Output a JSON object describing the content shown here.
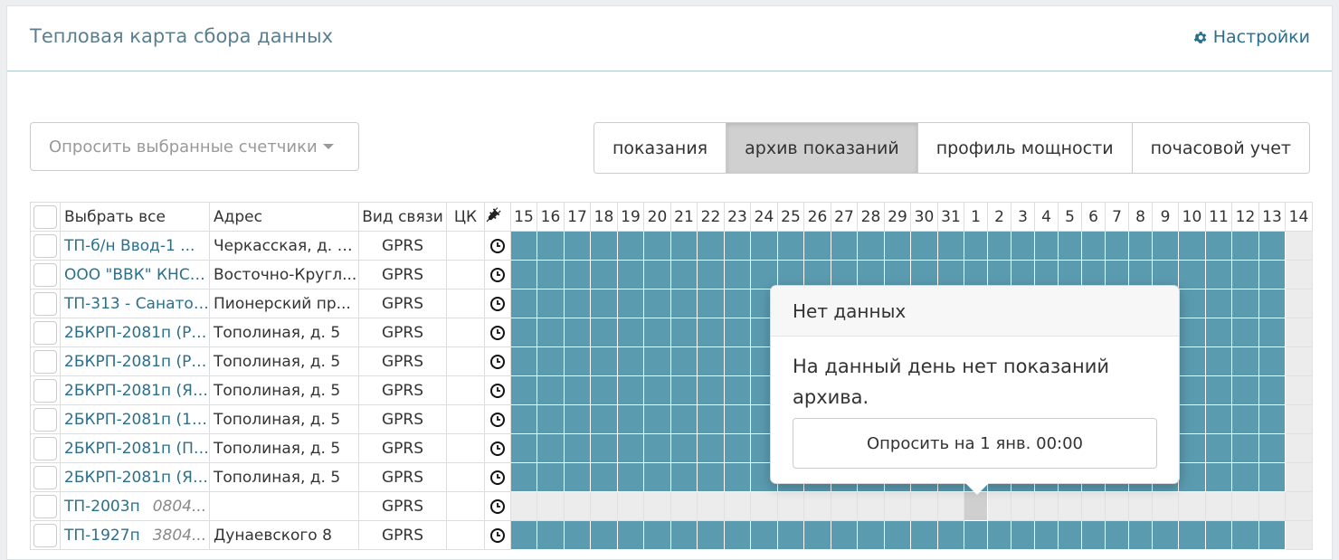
{
  "header": {
    "title": "Тепловая карта сбора данных",
    "settings_label": "Настройки"
  },
  "poll_button": {
    "label": "Опросить выбранные счетчики"
  },
  "tabs": [
    {
      "label": "показания",
      "active": false
    },
    {
      "label": "архив показаний",
      "active": true
    },
    {
      "label": "профиль мощности",
      "active": false
    },
    {
      "label": "почасовой учет",
      "active": false
    }
  ],
  "table": {
    "headers": {
      "select_all": "Выбрать все",
      "address": "Адрес",
      "connection": "Вид связи",
      "ck": "ЦК"
    },
    "days": [
      "15",
      "16",
      "17",
      "18",
      "19",
      "20",
      "21",
      "22",
      "23",
      "24",
      "25",
      "26",
      "27",
      "28",
      "29",
      "30",
      "31",
      "1",
      "2",
      "3",
      "4",
      "5",
      "6",
      "7",
      "8",
      "9",
      "10",
      "11",
      "12",
      "13",
      "14"
    ],
    "rows": [
      {
        "name": "ТП-б/н Ввод-1 ...",
        "sub": "",
        "address": "Черкасская, д. 7...",
        "connection": "GPRS",
        "filled": true
      },
      {
        "name": "ООО \"ВВК\" КНС ...",
        "sub": "",
        "address": "Восточно-Кругл...",
        "connection": "GPRS",
        "filled": true
      },
      {
        "name": "ТП-313 - Санато...",
        "sub": "",
        "address": "Пионерский пр...",
        "connection": "GPRS",
        "filled": true
      },
      {
        "name": "2БКРП-2081п (Р...",
        "sub": "",
        "address": "Тополиная, д. 5",
        "connection": "GPRS",
        "filled": true
      },
      {
        "name": "2БКРП-2081п (Р...",
        "sub": "",
        "address": "Тополиная, д. 5",
        "connection": "GPRS",
        "filled": true
      },
      {
        "name": "2БКРП-2081п (Я...",
        "sub": "",
        "address": "Тополиная, д. 5",
        "connection": "GPRS",
        "filled": true
      },
      {
        "name": "2БКРП-2081п (1...",
        "sub": "",
        "address": "Тополиная, д. 5",
        "connection": "GPRS",
        "filled": true
      },
      {
        "name": "2БКРП-2081п (П...",
        "sub": "",
        "address": "Тополиная, д. 5",
        "connection": "GPRS",
        "filled": true
      },
      {
        "name": "2БКРП-2081п (Я...",
        "sub": "",
        "address": "Тополиная, д. 5",
        "connection": "GPRS",
        "filled": true
      },
      {
        "name": "ТП-2003п",
        "sub": "0804...",
        "address": "",
        "connection": "GPRS",
        "filled": false
      },
      {
        "name": "ТП-1927п",
        "sub": "3804...",
        "address": "Дунаевского 8",
        "connection": "GPRS",
        "filled": true
      }
    ]
  },
  "popover": {
    "title": "Нет данных",
    "message": "На данный день нет показаний архива.",
    "button_label": "Опросить на 1 янв. 00:00"
  },
  "colors": {
    "filled": "#5b9bb0",
    "empty": "#ececec",
    "selected": "#cfcfcf",
    "link": "#2b6f8e"
  }
}
